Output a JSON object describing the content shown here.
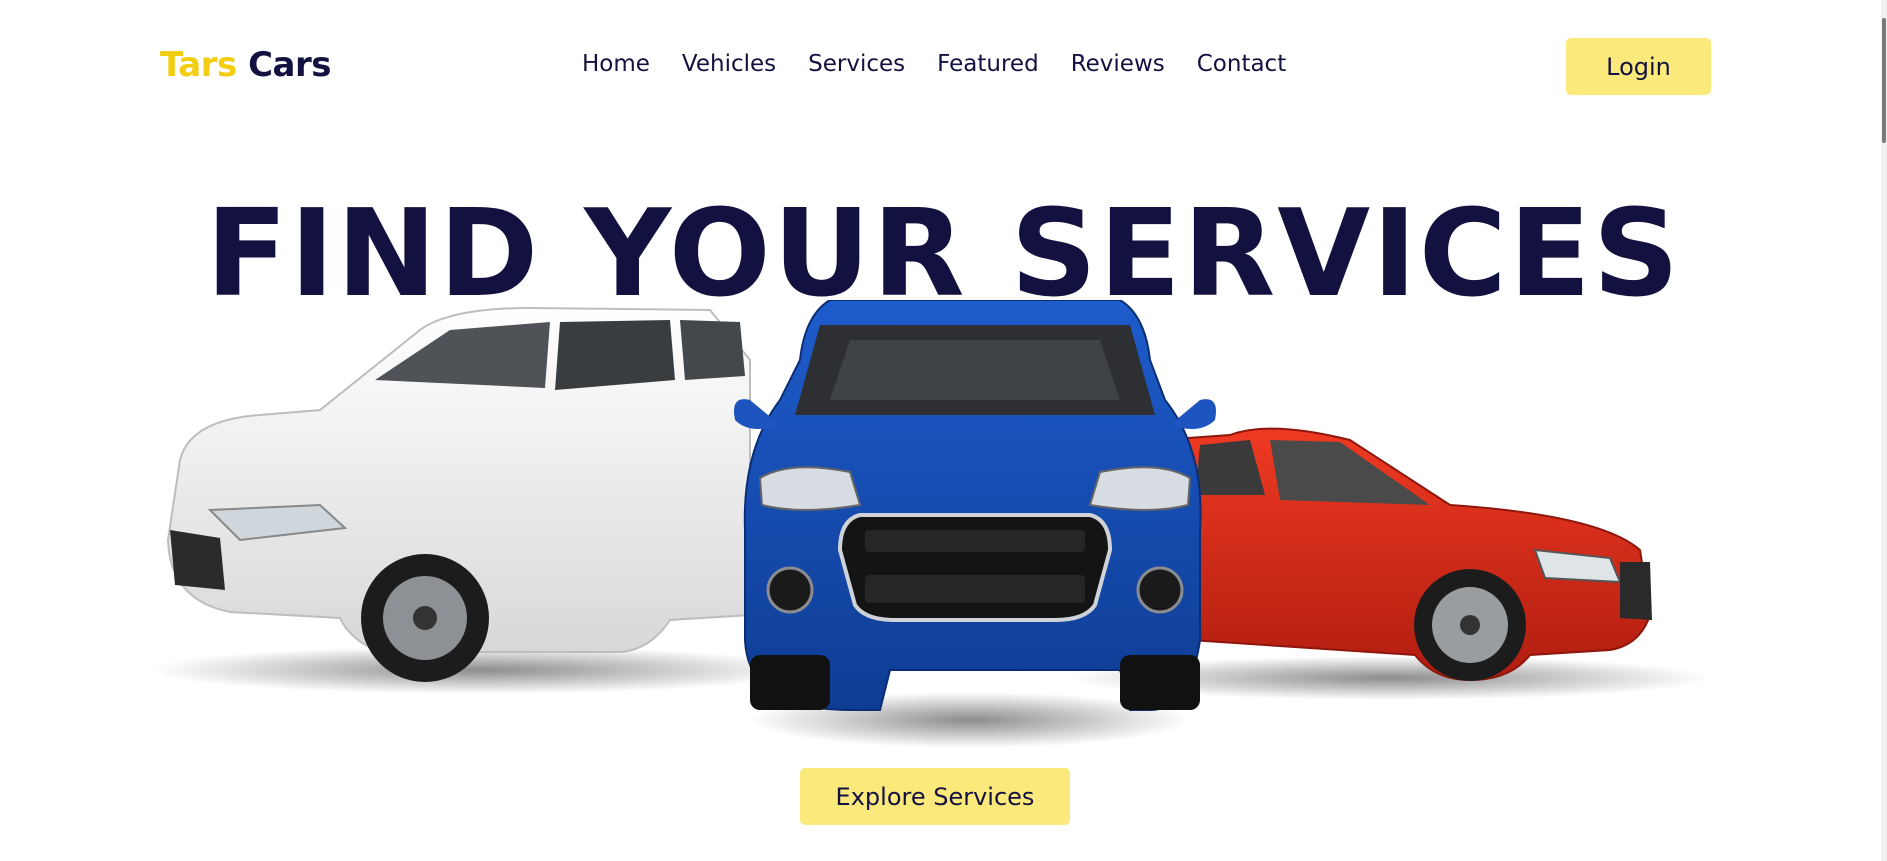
{
  "brand": {
    "first": "Tars",
    "second": "Cars"
  },
  "nav": {
    "items": [
      {
        "label": "Home"
      },
      {
        "label": "Vehicles"
      },
      {
        "label": "Services"
      },
      {
        "label": "Featured"
      },
      {
        "label": "Reviews"
      },
      {
        "label": "Contact"
      }
    ]
  },
  "header": {
    "login_label": "Login"
  },
  "hero": {
    "title": "FIND YOUR SERVICES",
    "cta_label": "Explore Services",
    "image": {
      "cars": [
        "white SUV",
        "blue compact SUV",
        "red sedan"
      ]
    }
  },
  "colors": {
    "brand_yellow": "#f2cd10",
    "navy": "#13113f",
    "button_yellow": "#fce97b",
    "white_car": "#f2f2f2",
    "blue_car": "#1850b5",
    "red_car": "#d92717"
  }
}
